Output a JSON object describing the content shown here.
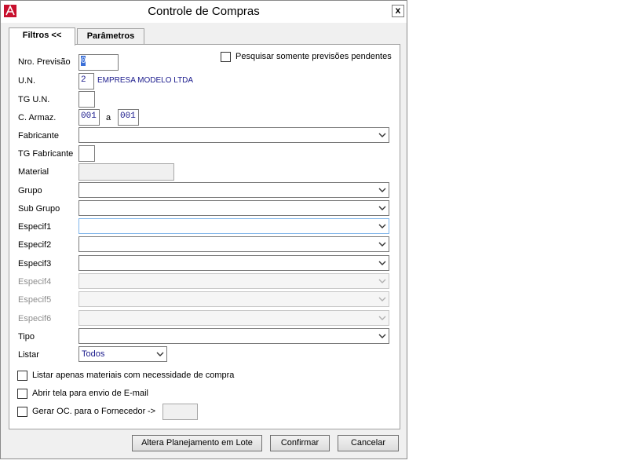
{
  "window": {
    "title": "Controle de Compras",
    "close_glyph": "x"
  },
  "tabs": [
    {
      "label": "Filtros <<"
    },
    {
      "label": "Parâmetros"
    }
  ],
  "filters": {
    "pending_checkbox_label": "Pesquisar somente previsões pendentes",
    "nro_previsao": {
      "label": "Nro. Previsão",
      "value": "0"
    },
    "un": {
      "label": "U.N.",
      "value": "2",
      "description": "EMPRESA MODELO LTDA"
    },
    "tg_un": {
      "label": "TG U.N.",
      "value": ""
    },
    "c_armaz": {
      "label": "C. Armaz.",
      "from": "001",
      "separator": "a",
      "to": "001"
    },
    "fabricante": {
      "label": "Fabricante",
      "value": ""
    },
    "tg_fabricante": {
      "label": "TG Fabricante",
      "value": ""
    },
    "material": {
      "label": "Material",
      "value": ""
    },
    "grupo": {
      "label": "Grupo",
      "value": ""
    },
    "sub_grupo": {
      "label": "Sub Grupo",
      "value": ""
    },
    "especif1": {
      "label": "Especif1",
      "value": ""
    },
    "especif2": {
      "label": "Especif2",
      "value": ""
    },
    "especif3": {
      "label": "Especif3",
      "value": ""
    },
    "especif4": {
      "label": "Especif4",
      "value": ""
    },
    "especif5": {
      "label": "Especif5",
      "value": ""
    },
    "especif6": {
      "label": "Especif6",
      "value": ""
    },
    "tipo": {
      "label": "Tipo",
      "value": ""
    },
    "listar": {
      "label": "Listar",
      "value": "Todos"
    },
    "options": {
      "only_needed_label": "Listar apenas materiais com necessidade de compra",
      "email_label": "Abrir tela para envio de E-mail",
      "gerar_oc_label": "Gerar OC. para o Fornecedor",
      "gerar_oc_arrow": "->",
      "fornecedor_value": ""
    }
  },
  "buttons": {
    "altera": "Altera Planejamento em Lote",
    "confirmar": "Confirmar",
    "cancelar": "Cancelar"
  },
  "colors": {
    "value_text": "#1a1a8c",
    "disabled_text": "#8d8d8d",
    "focus_border": "#7eb4ea"
  }
}
